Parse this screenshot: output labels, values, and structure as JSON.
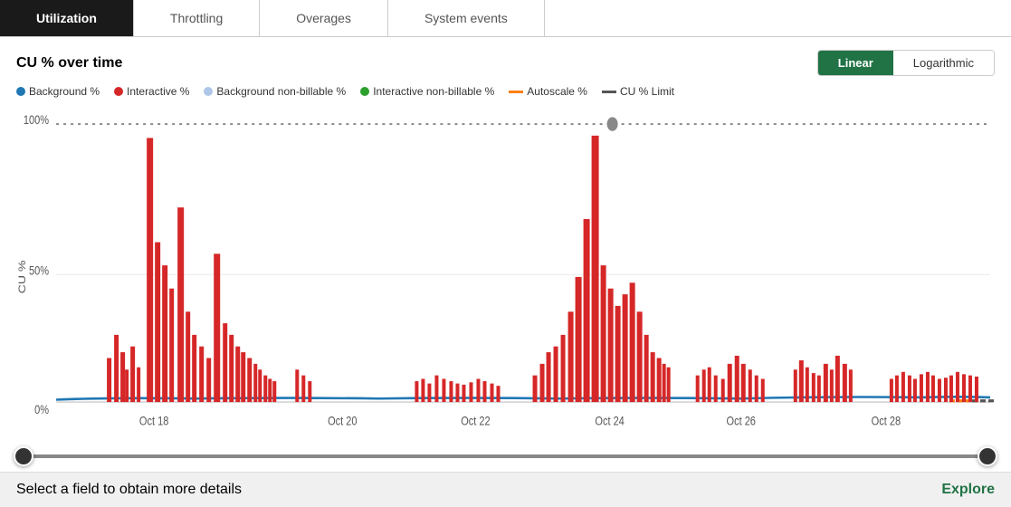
{
  "tabs": [
    {
      "id": "utilization",
      "label": "Utilization",
      "active": true
    },
    {
      "id": "throttling",
      "label": "Throttling",
      "active": false
    },
    {
      "id": "overages",
      "label": "Overages",
      "active": false
    },
    {
      "id": "system-events",
      "label": "System events",
      "active": false
    }
  ],
  "chart": {
    "title": "CU % over time",
    "scale_buttons": [
      {
        "id": "linear",
        "label": "Linear",
        "active": true
      },
      {
        "id": "logarithmic",
        "label": "Logarithmic",
        "active": false
      }
    ],
    "legend": [
      {
        "id": "background-pct",
        "label": "Background %",
        "type": "dot",
        "color": "#1f77b4"
      },
      {
        "id": "interactive-pct",
        "label": "Interactive %",
        "type": "dot",
        "color": "#d62728"
      },
      {
        "id": "background-non-billable",
        "label": "Background non-billable %",
        "type": "dot",
        "color": "#aec7e8"
      },
      {
        "id": "interactive-non-billable",
        "label": "Interactive non-billable %",
        "type": "dot",
        "color": "#2ca02c"
      },
      {
        "id": "autoscale-pct",
        "label": "Autoscale %",
        "type": "dash",
        "color": "#ff7f0e"
      },
      {
        "id": "cu-pct-limit",
        "label": "CU % Limit",
        "type": "dash",
        "color": "#555555"
      }
    ],
    "y_labels": [
      "100%",
      "50%",
      "0%"
    ],
    "x_labels": [
      "Oct 18",
      "Oct 20",
      "Oct 22",
      "Oct 24",
      "Oct 26",
      "Oct 28"
    ],
    "y_axis_label": "CU %"
  },
  "slider": {
    "left_value": 0,
    "right_value": 100
  },
  "bottom": {
    "prompt": "Select a field to obtain more details",
    "action": "Explore"
  }
}
